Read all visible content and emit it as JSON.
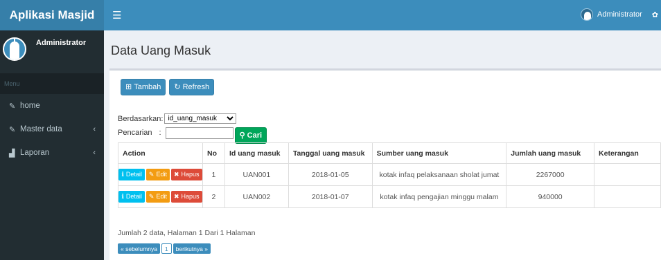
{
  "app": {
    "title": "Aplikasi Masjid"
  },
  "topbar": {
    "menu_icon": "☰",
    "user_name": "Administrator"
  },
  "sidebar": {
    "user_name": "Administrator",
    "menu_header": "Menu",
    "items": [
      {
        "label": "home",
        "icon": "edit-icon"
      },
      {
        "label": "Master data",
        "icon": "edit-icon",
        "chevron": "‹"
      },
      {
        "label": "Laporan",
        "icon": "bar-chart-icon",
        "chevron": "‹"
      }
    ]
  },
  "page": {
    "title": "Data Uang Masuk"
  },
  "toolbar": {
    "add_label": "Tambah",
    "refresh_label": "Refresh"
  },
  "filter": {
    "by_label": "Berdasarkan:",
    "selected": "id_uang_masuk",
    "search_label": "Pencarian",
    "search_sep": ":",
    "search_value": "",
    "search_button": "Cari"
  },
  "table": {
    "headers": [
      "Action",
      "No",
      "Id uang masuk",
      "Tanggal uang masuk",
      "Sumber uang masuk",
      "Jumlah uang masuk",
      "Keterangan"
    ],
    "action_labels": {
      "detail": "Detail",
      "edit": "Edit",
      "delete": "Hapus"
    },
    "rows": [
      {
        "no": "1",
        "id": "UAN001",
        "tanggal": "2018-01-05",
        "sumber": "kotak infaq pelaksanaan sholat jumat",
        "jumlah": "2267000",
        "keterangan": ""
      },
      {
        "no": "2",
        "id": "UAN002",
        "tanggal": "2018-01-07",
        "sumber": "kotak infaq pengajian minggu malam",
        "jumlah": "940000",
        "keterangan": ""
      }
    ]
  },
  "summary": "Jumlah 2 data, Halaman 1 Dari 1 Halaman",
  "pagination": {
    "prev": "« sebelumnya",
    "page": "1",
    "next": "berikutnya »"
  },
  "colors": {
    "header": "#3c8dbc",
    "logo": "#367fa9",
    "sidebar": "#222d32",
    "info": "#00c0ef",
    "warning": "#f39c12",
    "danger": "#dd4b39",
    "success": "#00a65a"
  }
}
